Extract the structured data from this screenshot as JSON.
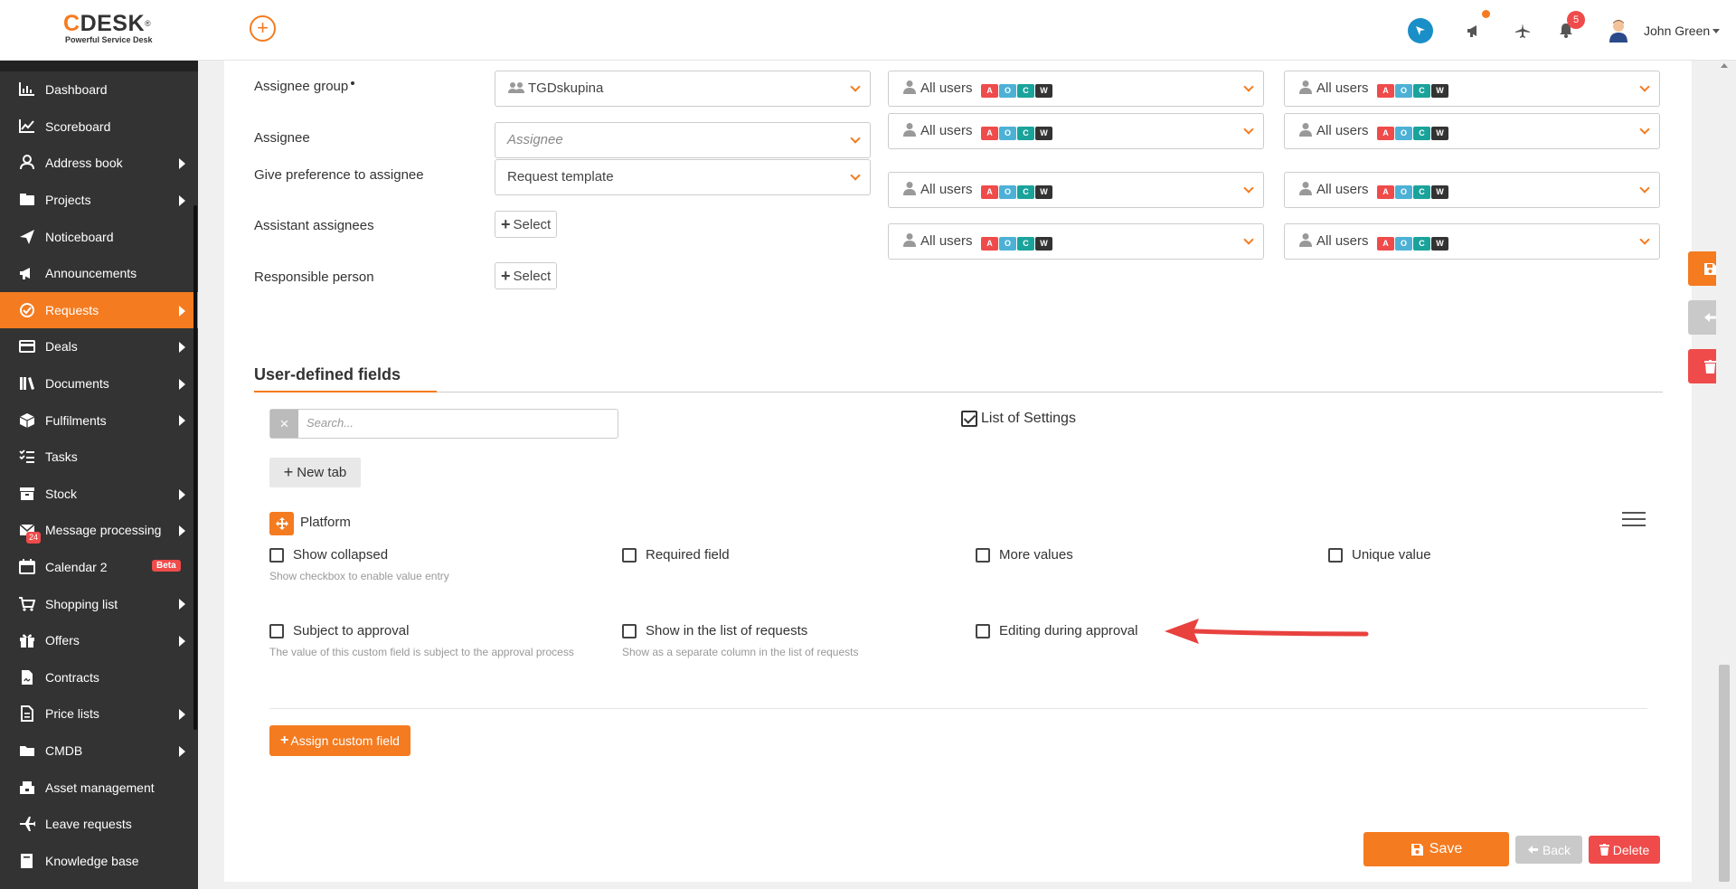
{
  "header": {
    "logo_main": "DESK",
    "logo_c": "C",
    "logo_reg": "®",
    "logo_sub": "Powerful Service Desk",
    "add_symbol": "+",
    "notification_count": "5",
    "user_name": "John Green"
  },
  "sidebar": {
    "items": [
      {
        "label": "Dashboard",
        "icon": "dashboard-icon",
        "arrow": false
      },
      {
        "label": "Scoreboard",
        "icon": "chart-line-icon",
        "arrow": false
      },
      {
        "label": "Address book",
        "icon": "person-icon",
        "arrow": true
      },
      {
        "label": "Projects",
        "icon": "projects-icon",
        "arrow": true
      },
      {
        "label": "Noticeboard",
        "icon": "paper-plane-icon",
        "arrow": false
      },
      {
        "label": "Announcements",
        "icon": "megaphone-icon",
        "arrow": false
      },
      {
        "label": "Requests",
        "icon": "requests-icon",
        "arrow": true,
        "active": true
      },
      {
        "label": "Deals",
        "icon": "card-icon",
        "arrow": true
      },
      {
        "label": "Documents",
        "icon": "books-icon",
        "arrow": true
      },
      {
        "label": "Fulfilments",
        "icon": "box-icon",
        "arrow": true
      },
      {
        "label": "Tasks",
        "icon": "tasks-icon",
        "arrow": false
      },
      {
        "label": "Stock",
        "icon": "archive-icon",
        "arrow": true
      },
      {
        "label": "Message processing",
        "icon": "envelope-icon",
        "arrow": true,
        "badge": "24"
      },
      {
        "label": "Calendar 2",
        "icon": "calendar-icon",
        "arrow": false,
        "beta": "Beta"
      },
      {
        "label": "Shopping list",
        "icon": "cart-icon",
        "arrow": true
      },
      {
        "label": "Offers",
        "icon": "gift-icon",
        "arrow": true
      },
      {
        "label": "Contracts",
        "icon": "contract-icon",
        "arrow": false
      },
      {
        "label": "Price lists",
        "icon": "price-list-icon",
        "arrow": true
      },
      {
        "label": "CMDB",
        "icon": "folder-icon",
        "arrow": true
      },
      {
        "label": "Asset management",
        "icon": "asset-icon",
        "arrow": false
      },
      {
        "label": "Leave requests",
        "icon": "plane-icon",
        "arrow": false
      },
      {
        "label": "Knowledge base",
        "icon": "book-icon",
        "arrow": false
      }
    ]
  },
  "form": {
    "assignee_group_label": "Assignee group",
    "assignee_group_value": "TGDskupina",
    "assignee_label": "Assignee",
    "assignee_placeholder": "Assignee",
    "preference_label": "Give preference to assignee",
    "preference_value": "Request template",
    "assistant_label": "Assistant assignees",
    "responsible_label": "Responsible person",
    "select_label": "Select",
    "all_users": "All users",
    "chips": [
      "A",
      "O",
      "C",
      "W"
    ]
  },
  "udf": {
    "title": "User-defined fields",
    "search_placeholder": "Search...",
    "search_clear": "×",
    "list_of_settings": "List of Settings",
    "new_tab": "New tab",
    "platform": "Platform",
    "options": {
      "show_collapsed": "Show collapsed",
      "show_collapsed_hint": "Show checkbox to enable value entry",
      "required_field": "Required field",
      "more_values": "More values",
      "unique_value": "Unique value",
      "subject_to_approval": "Subject to approval",
      "subject_to_approval_hint": "The value of this custom field is subject to the approval process",
      "show_in_list": "Show in the list of requests",
      "show_in_list_hint": "Show as a separate column in the list of requests",
      "editing_during_approval": "Editing during approval"
    },
    "assign_custom_field": "Assign custom field"
  },
  "actions": {
    "save": "Save",
    "back": "Back",
    "delete": "Delete"
  },
  "colors": {
    "accent": "#f47b20",
    "danger": "#ef4b4b",
    "sidebar": "#333333",
    "arrow": "#e8413e"
  }
}
